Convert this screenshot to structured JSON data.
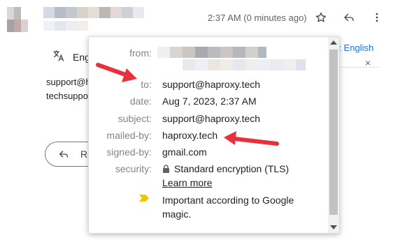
{
  "header": {
    "time": "2:37 AM (0 minutes ago)",
    "star_icon": "star-outline-icon",
    "reply_icon": "reply-arrow-icon",
    "more_icon": "more-vert-icon"
  },
  "translate": {
    "icon": "translate-icon",
    "language_partial": "Engl",
    "right_text": "r: English",
    "close_symbol": "×"
  },
  "body": {
    "line1": "support@ha",
    "line2": "techsuppo"
  },
  "reply_button": {
    "label": "Re"
  },
  "popup": {
    "rows": [
      {
        "label": "from:",
        "value": ""
      },
      {
        "label": "to:",
        "value": "support@haproxy.tech"
      },
      {
        "label": "date:",
        "value": "Aug 7, 2023, 2:37 AM"
      },
      {
        "label": "subject:",
        "value": "support@haproxy.tech"
      },
      {
        "label": "mailed-by:",
        "value": "haproxy.tech"
      },
      {
        "label": "signed-by:",
        "value": "gmail.com"
      },
      {
        "label": "security:",
        "value": "Standard encryption (TLS)"
      }
    ],
    "learn_more": "Learn more",
    "important_line1": "Important according to Google",
    "important_line2": "magic."
  },
  "colors": {
    "annotation_arrow": "#e8313b",
    "importance_marker": "#f2c500",
    "label_gray": "#80868b",
    "link_blue": "#1a73e8"
  }
}
